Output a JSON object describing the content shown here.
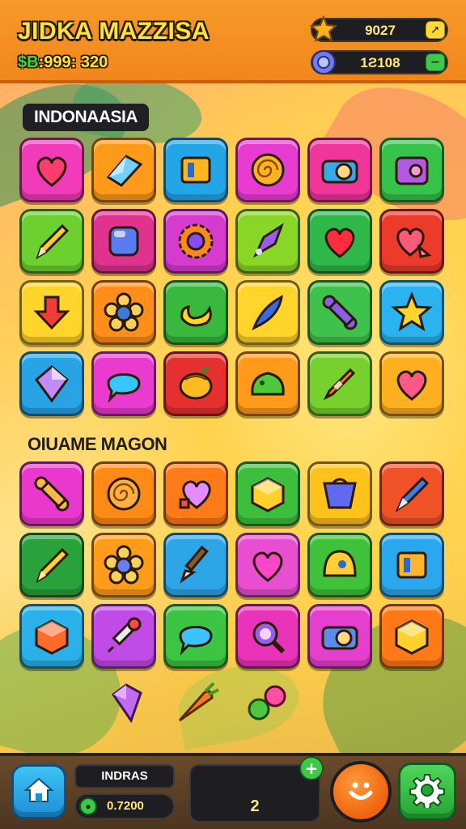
{
  "header": {
    "title": "JIDKA MAZZISA",
    "score_prefix": "$B",
    "score_text": ":999: 320",
    "resource_1": {
      "value": "9027",
      "icon": "star-gem-icon",
      "button_icon": "arrow-icon"
    },
    "resource_2": {
      "value": "1Ƨ108",
      "icon": "gear-token-icon",
      "button_icon": "minus-icon"
    }
  },
  "sections": [
    {
      "label": "INDONAASIA"
    },
    {
      "label": "OIUAME MAGON"
    }
  ],
  "grid_1": {
    "tiles": [
      {
        "name": "heart-icon",
        "color": "#f23bb8",
        "glyph": "#ff3d6e"
      },
      {
        "name": "crystal-icon",
        "color": "#ff9a1a",
        "glyph": "#6fd0ff"
      },
      {
        "name": "box-icon",
        "color": "#23a6e8",
        "glyph": "#ffb51f"
      },
      {
        "name": "swirl-candy-icon",
        "color": "#e83cd0",
        "glyph": "#ffb321"
      },
      {
        "name": "camera-icon",
        "color": "#f0359b",
        "glyph": "#3aa8e8"
      },
      {
        "name": "radio-icon",
        "color": "#36c34a",
        "glyph": "#b05be0"
      },
      {
        "name": "pencil-icon",
        "color": "#6cd12f",
        "glyph": "#ffcc33"
      },
      {
        "name": "square-gem-icon",
        "color": "#e0338f",
        "glyph": "#5a7cf0"
      },
      {
        "name": "gear-flower-icon",
        "color": "#d63bd0",
        "glyph": "#ff8a1a"
      },
      {
        "name": "pen-nib-icon",
        "color": "#8ad627",
        "glyph": "#9b5de5"
      },
      {
        "name": "heart-icon",
        "color": "#2fb84a",
        "glyph": "#ff2d3d"
      },
      {
        "name": "heart-cursor-icon",
        "color": "#ec3a2b",
        "glyph": "#ff5a7a"
      },
      {
        "name": "arrow-down-icon",
        "color": "#ffd52b",
        "glyph": "#f23b3b"
      },
      {
        "name": "flower-icon",
        "color": "#ff8f1a",
        "glyph": "#3d7bdb"
      },
      {
        "name": "banana-icon",
        "color": "#38b83d",
        "glyph": "#ffd52b"
      },
      {
        "name": "feather-pen-icon",
        "color": "#ffd52b",
        "glyph": "#3a6be0"
      },
      {
        "name": "bone-icon",
        "color": "#3fc24b",
        "glyph": "#8a5ee6"
      },
      {
        "name": "star-icon",
        "color": "#2ab3ee",
        "glyph": "#ffd52b"
      },
      {
        "name": "diamond-icon",
        "color": "#27a3e6",
        "glyph": "#c08cff"
      },
      {
        "name": "speech-bubble-icon",
        "color": "#e93bcd",
        "glyph": "#36c7ff"
      },
      {
        "name": "melon-icon",
        "color": "#e63030",
        "glyph": "#ffbb22"
      },
      {
        "name": "slime-icon",
        "color": "#ff9a1a",
        "glyph": "#4ec93d"
      },
      {
        "name": "crayon-icon",
        "color": "#77d02b",
        "glyph": "#ff7a2e"
      },
      {
        "name": "heart-icon",
        "color": "#ffb020",
        "glyph": "#ff5a86"
      }
    ]
  },
  "grid_2": {
    "tiles": [
      {
        "name": "bone-icon",
        "color": "#ea37cc",
        "glyph": "#ffb84a"
      },
      {
        "name": "swirl-candy-icon",
        "color": "#ff8a16",
        "glyph": "#ffb040"
      },
      {
        "name": "heart-lock-icon",
        "color": "#ff7a18",
        "glyph": "#e38cff"
      },
      {
        "name": "cube-icon",
        "color": "#3dbf3d",
        "glyph": "#ffd12a"
      },
      {
        "name": "basket-icon",
        "color": "#ffc21a",
        "glyph": "#5f6af0"
      },
      {
        "name": "pen-icon",
        "color": "#f05228",
        "glyph": "#3e7ee8"
      },
      {
        "name": "pencil-icon",
        "color": "#2aa23b",
        "glyph": "#ffd52b"
      },
      {
        "name": "flower-icon",
        "color": "#ff9d1a",
        "glyph": "#6a7cf2"
      },
      {
        "name": "brush-icon",
        "color": "#2ea5e6",
        "glyph": "#e7e7f2"
      },
      {
        "name": "heart-icon",
        "color": "#e84fd0",
        "glyph": "#ff45c9"
      },
      {
        "name": "helmet-icon",
        "color": "#3fc23a",
        "glyph": "#ffcf33"
      },
      {
        "name": "box-icon",
        "color": "#2aa8ee",
        "glyph": "#ffb52b"
      },
      {
        "name": "cube-icon",
        "color": "#2ab1ea",
        "glyph": "#ff6b2b"
      },
      {
        "name": "syringe-icon",
        "color": "#c04be6",
        "glyph": "#ff4a4a"
      },
      {
        "name": "speech-bubble-icon",
        "color": "#3cc542",
        "glyph": "#3cc3ff"
      },
      {
        "name": "magnifier-icon",
        "color": "#e933b8",
        "glyph": "#9a5de8"
      },
      {
        "name": "camera-icon",
        "color": "#e63fcd",
        "glyph": "#5b8bef"
      },
      {
        "name": "cube-icon",
        "color": "#ff7a16",
        "glyph": "#ffd22b"
      }
    ]
  },
  "loose_items": [
    {
      "name": "gem-shard-icon",
      "color": "#c16cf0"
    },
    {
      "name": "carrot-icon",
      "color": "#ff7a1a"
    },
    {
      "name": "berries-icon",
      "color": "#ff4fa0"
    }
  ],
  "footer": {
    "home_icon": "home-icon",
    "player_name": "INDRAS",
    "coins": "0.7200",
    "count": "2",
    "plus_label": "+",
    "smile_icon": "smile-icon",
    "settings_icon": "gear-icon"
  }
}
